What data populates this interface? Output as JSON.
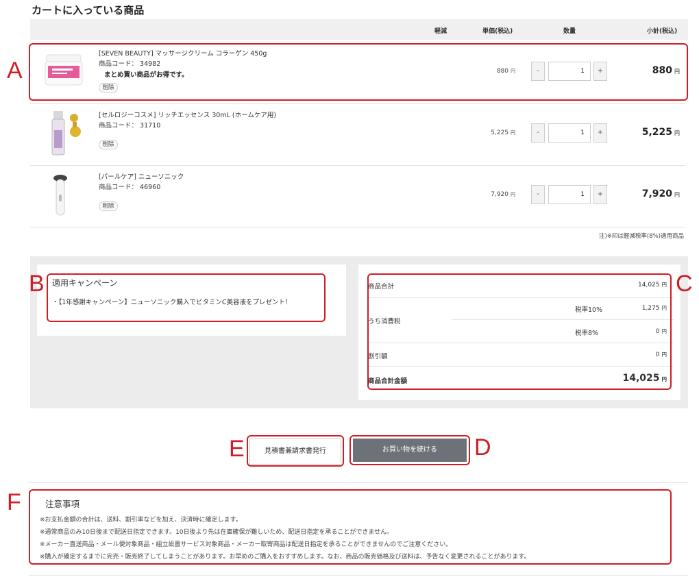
{
  "page_title": "カートに入っている商品",
  "table_headers": {
    "reduced_tax": "軽減",
    "unit_price": "単価(税込)",
    "quantity": "数量",
    "subtotal": "小計(税込)"
  },
  "items": [
    {
      "name": "[SEVEN BEAUTY] マッサージクリーム コラーゲン 450g",
      "code": "商品コード： 34982",
      "promo": "まとめ買い商品がお得です。",
      "delete_label": "削除",
      "unit_price": "880",
      "quantity": "1",
      "subtotal": "880",
      "icon": "cream-jar-icon"
    },
    {
      "name": "[セルロジーコスメ] リッチエッセンス 30mL (ホームケア用)",
      "code": "商品コード： 31710",
      "promo": "",
      "delete_label": "削除",
      "unit_price": "5,225",
      "quantity": "1",
      "subtotal": "5,225",
      "icon": "essence-bottle-icon"
    },
    {
      "name": "[パールケア] ニューソニック",
      "code": "商品コード： 46960",
      "promo": "",
      "delete_label": "削除",
      "unit_price": "7,920",
      "quantity": "1",
      "subtotal": "7,920",
      "icon": "sonic-device-icon"
    }
  ],
  "yen": "円",
  "qty_minus": "-",
  "qty_plus": "+",
  "tax_note": "注)※印は軽減税率(8%)適用商品",
  "campaign": {
    "title": "適用キャンペーン",
    "text": "・【1年感謝キャンペーン】ニューソニック購入でビタミンC美容液をプレゼント！"
  },
  "totals": {
    "product_total_label": "商品合計",
    "product_total": "14,025",
    "consumption_tax_label": "うち消費税",
    "tax10_label": "税率10%",
    "tax10_value": "1,275",
    "tax8_label": "税率8%",
    "tax8_value": "0",
    "discount_label": "割引額",
    "discount_value": "0",
    "grand_total_label": "商品合計金額",
    "grand_total": "14,025"
  },
  "buttons": {
    "estimate": "見積書兼請求書発行",
    "continue": "お買い物を続ける"
  },
  "notice": {
    "title": "注意事項",
    "lines": [
      "※お支払金額の合計は、送料、割引率などを加え、決済時に確定します。",
      "※通常商品のみ10日後まで配送日指定できます。10日後より先は在庫確保が難しいため、配送日指定を承ることができません。",
      "※メーカー直送商品・メール便対象商品・組立設置サービス対象商品・メーカー取寄商品は配送日指定を承ることができませんのでご注意ください。",
      "※購入が確定するまでに完売・販売終了してしまうことがあります。お早めのご購入をおすすめします。なお、商品の販売価格及び送料は、予告なく変更されることがあります。"
    ]
  },
  "annotations": [
    "A",
    "B",
    "C",
    "D",
    "E",
    "F"
  ],
  "colors": {
    "annotation_red": "#d01c24",
    "continue_button": "#6d7278",
    "band_gray": "#ececec"
  }
}
